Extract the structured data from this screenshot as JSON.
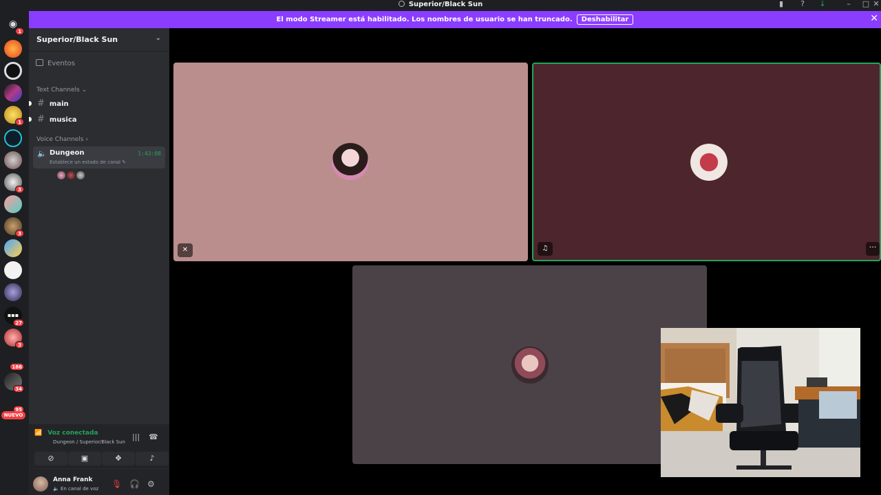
{
  "window": {
    "title": "Superior/Black Sun",
    "controls": [
      "minimize-icon",
      "maximize-icon",
      "close-icon"
    ]
  },
  "banner": {
    "message": "El modo Streamer está habilitado. Los nombres de usuario se han truncado.",
    "button_label": "Deshabilitar",
    "color": "#8b3dff"
  },
  "rail": {
    "badges": [
      "1",
      "1",
      "3",
      "3",
      "27",
      "3",
      "186",
      "34",
      "95"
    ],
    "new_label": "NUEVO"
  },
  "server": {
    "name": "Superior/Black Sun",
    "events_label": "Eventos",
    "text_category": "Text Channels",
    "text_channels": [
      {
        "name": "main"
      },
      {
        "name": "musica"
      }
    ],
    "voice_category": "Voice Channels",
    "voice_channel": {
      "name": "Dungeon",
      "timer": "1:43:08",
      "status": "Establece un estado de canal"
    }
  },
  "voice_panel": {
    "status": "Voz conectada",
    "location": "Dungeon / Superior/Black Sun",
    "status_color": "#23a559"
  },
  "user": {
    "name": "Anna Frank",
    "status": "En canal de voz"
  },
  "stage": {
    "tiles": [
      {
        "bg": "#b98e8d",
        "muted": true
      },
      {
        "bg": "#4c262c",
        "speaking": true
      },
      {
        "bg": "#4b4248"
      }
    ]
  }
}
